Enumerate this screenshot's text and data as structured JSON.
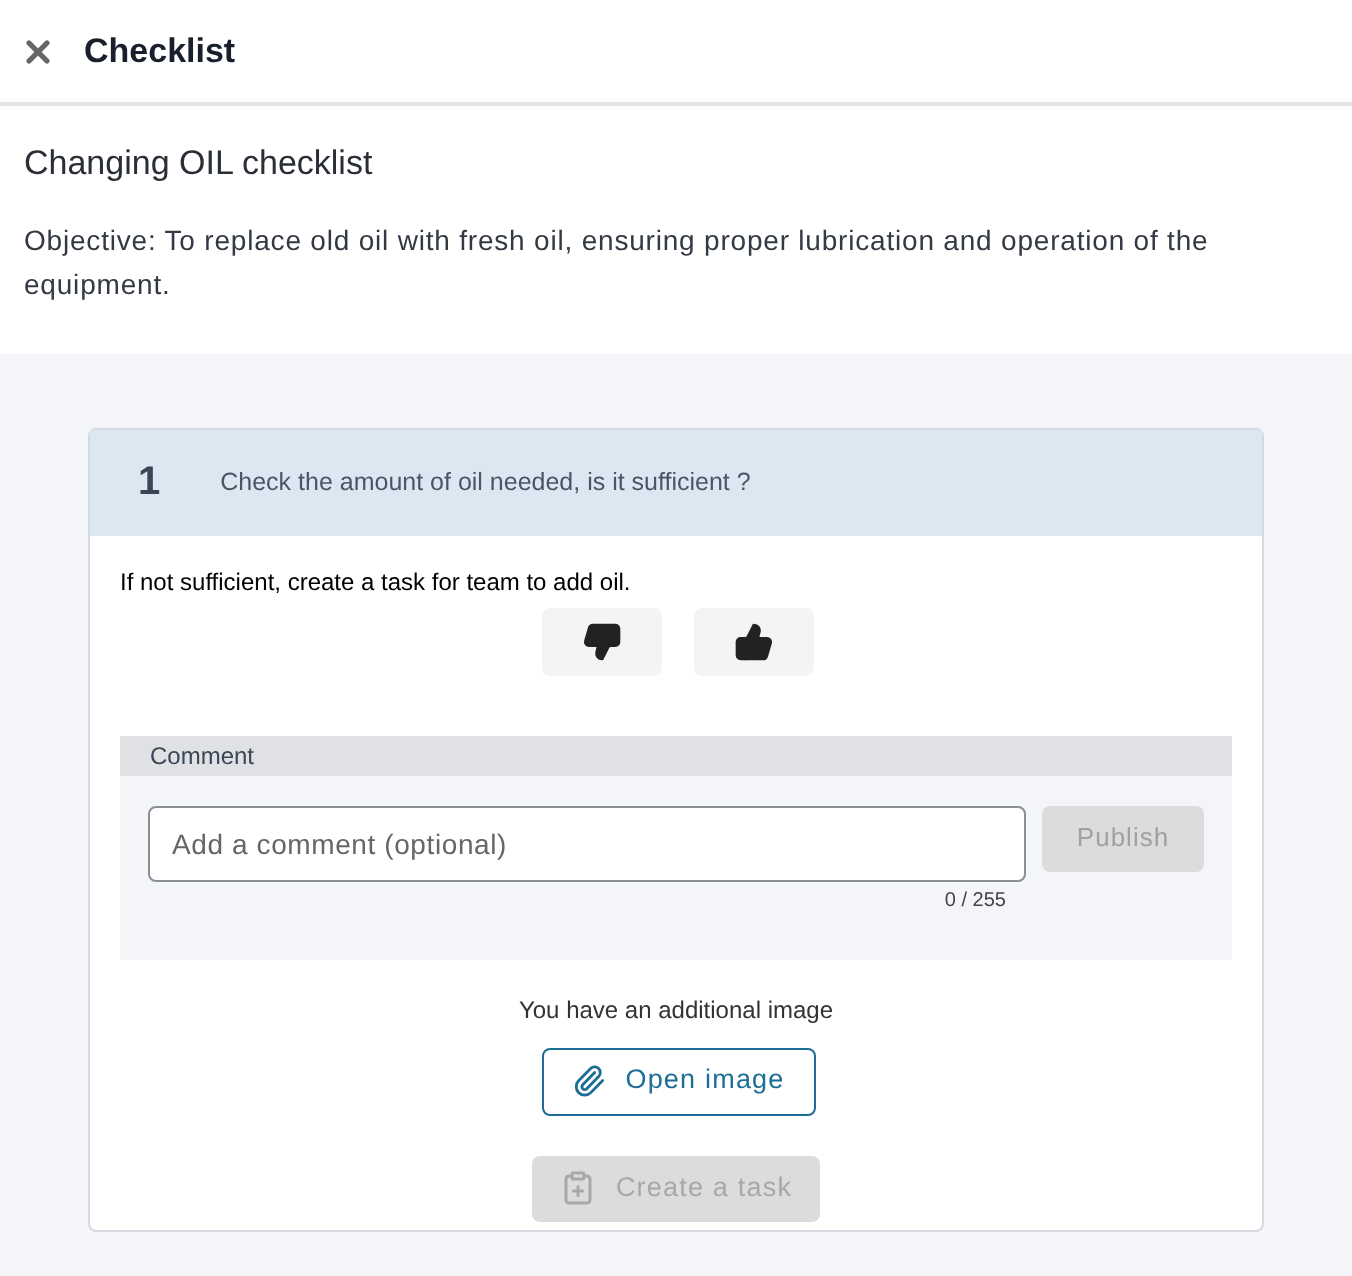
{
  "header": {
    "title": "Checklist"
  },
  "checklist": {
    "title": "Changing OIL checklist",
    "objective": "Objective: To replace old oil with fresh oil, ensuring proper lubrication and operation of the equipment."
  },
  "question": {
    "number": "1",
    "text": "Check the amount of oil needed, is it sufficient ?",
    "instruction": "If not sufficient, create a task for team to add oil.",
    "answers": [
      {
        "kind": "no"
      },
      {
        "kind": "yes"
      }
    ]
  },
  "comment": {
    "label": "Comment",
    "placeholder": "Add a comment (optional)",
    "counter": "0 / 255",
    "publish": {
      "label": "Publish",
      "disabled": true
    }
  },
  "image": {
    "note": "You have an additional image",
    "button": "Open image"
  },
  "create_task": {
    "label": "Create a task",
    "disabled": true
  }
}
